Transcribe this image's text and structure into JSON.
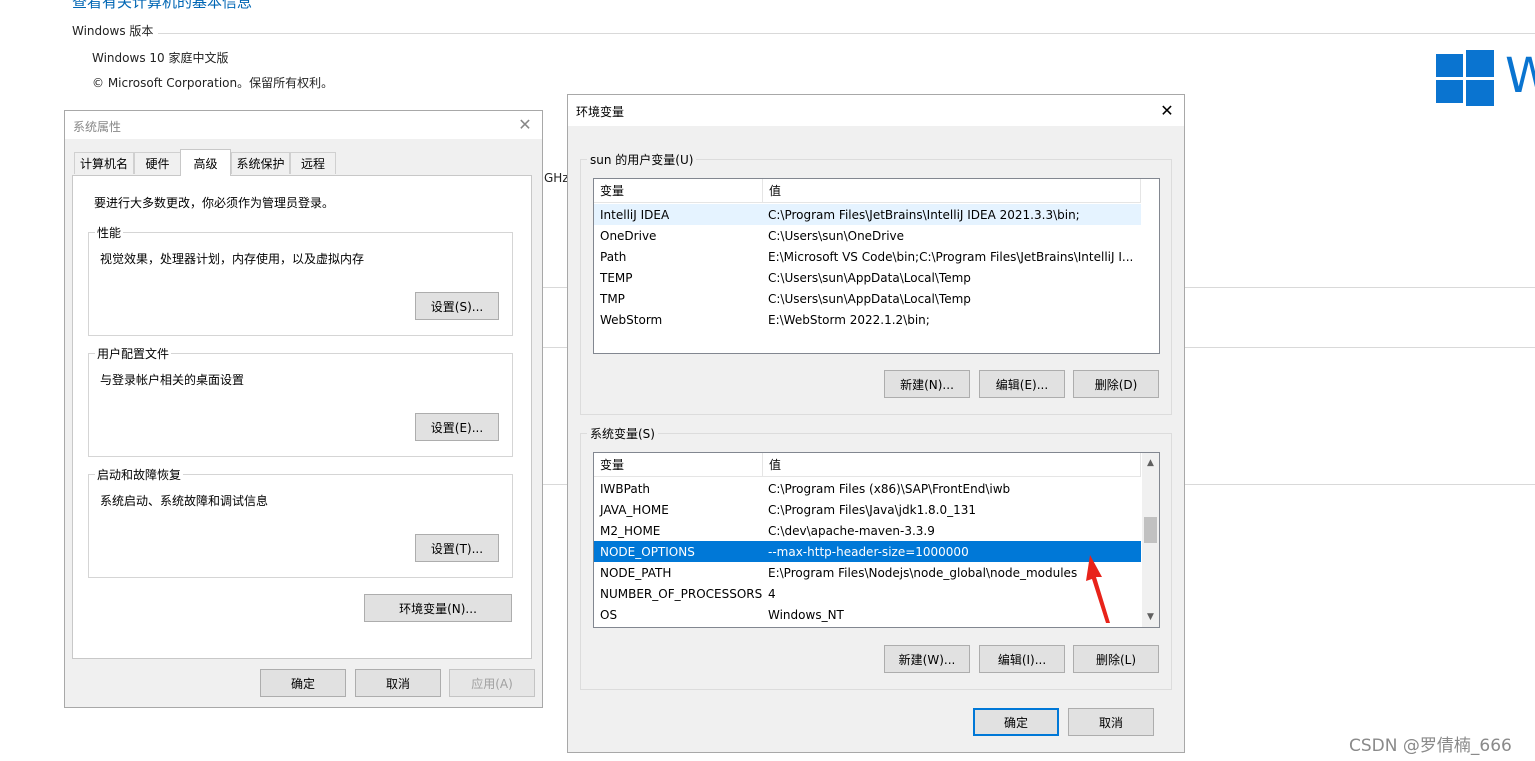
{
  "background": {
    "heading": "查看有关计算机的基本信息",
    "windows_edition_section": "Windows 版本",
    "edition": "Windows 10 家庭中文版",
    "copyright": "© Microsoft Corporation。保留所有权利。",
    "ghz_fragment": "GHz",
    "logo_letter": "W",
    "brand_color": "#0a74d0"
  },
  "watermark": "CSDN @罗倩楠_666",
  "sysprops": {
    "title": "系统属性",
    "close_glyph": "✕",
    "tabs": [
      {
        "label": "计算机名"
      },
      {
        "label": "硬件"
      },
      {
        "label": "高级"
      },
      {
        "label": "系统保护"
      },
      {
        "label": "远程"
      }
    ],
    "active_tab": "高级",
    "admin_note": "要进行大多数更改，你必须作为管理员登录。",
    "performance": {
      "label": "性能",
      "desc": "视觉效果，处理器计划，内存使用，以及虚拟内存",
      "button": "设置(S)..."
    },
    "user_profiles": {
      "label": "用户配置文件",
      "desc": "与登录帐户相关的桌面设置",
      "button": "设置(E)..."
    },
    "startup_recovery": {
      "label": "启动和故障恢复",
      "desc": "系统启动、系统故障和调试信息",
      "button": "设置(T)..."
    },
    "env_vars_button": "环境变量(N)...",
    "ok": "确定",
    "cancel": "取消",
    "apply": "应用(A)"
  },
  "envdialog": {
    "title": "环境变量",
    "close_glyph": "✕",
    "user_section": "sun 的用户变量(U)",
    "system_section": "系统变量(S)",
    "col_variable": "变量",
    "col_value": "值",
    "user_vars": [
      {
        "name": "IntelliJ IDEA",
        "value": "C:\\Program Files\\JetBrains\\IntelliJ IDEA 2021.3.3\\bin;"
      },
      {
        "name": "OneDrive",
        "value": "C:\\Users\\sun\\OneDrive"
      },
      {
        "name": "Path",
        "value": "E:\\Microsoft VS Code\\bin;C:\\Program Files\\JetBrains\\IntelliJ I..."
      },
      {
        "name": "TEMP",
        "value": "C:\\Users\\sun\\AppData\\Local\\Temp"
      },
      {
        "name": "TMP",
        "value": "C:\\Users\\sun\\AppData\\Local\\Temp"
      },
      {
        "name": "WebStorm",
        "value": "E:\\WebStorm 2022.1.2\\bin;"
      }
    ],
    "system_vars": [
      {
        "name": "IWBPath",
        "value": "C:\\Program Files (x86)\\SAP\\FrontEnd\\iwb"
      },
      {
        "name": "JAVA_HOME",
        "value": "C:\\Program Files\\Java\\jdk1.8.0_131"
      },
      {
        "name": "M2_HOME",
        "value": "C:\\dev\\apache-maven-3.3.9"
      },
      {
        "name": "NODE_OPTIONS",
        "value": "--max-http-header-size=1000000"
      },
      {
        "name": "NODE_PATH",
        "value": "E:\\Program Files\\Nodejs\\node_global\\node_modules"
      },
      {
        "name": "NUMBER_OF_PROCESSORS",
        "value": "4"
      },
      {
        "name": "OS",
        "value": "Windows_NT"
      }
    ],
    "selected_system_var": "NODE_OPTIONS",
    "user_buttons": {
      "new": "新建(N)...",
      "edit": "编辑(E)...",
      "delete": "删除(D)"
    },
    "system_buttons": {
      "new": "新建(W)...",
      "edit": "编辑(I)...",
      "delete": "删除(L)"
    },
    "ok": "确定",
    "cancel": "取消",
    "selection_color": "#0078d7",
    "annotation_arrow_color": "#e8231a"
  }
}
